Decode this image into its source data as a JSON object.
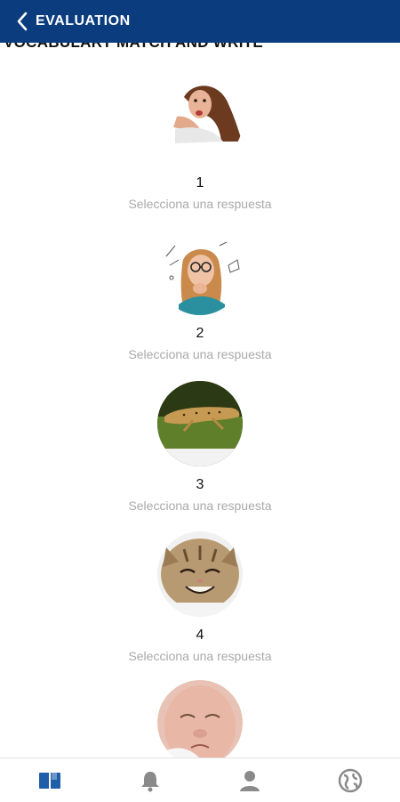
{
  "header": {
    "title": "EVALUATION"
  },
  "section": {
    "title": "VOCABULARY MATCH AND WRITE"
  },
  "items": [
    {
      "number": "1",
      "hint": "Selecciona una respuesta"
    },
    {
      "number": "2",
      "hint": "Selecciona una respuesta"
    },
    {
      "number": "3",
      "hint": "Selecciona una respuesta"
    },
    {
      "number": "4",
      "hint": "Selecciona una respuesta"
    }
  ],
  "nav": {
    "icons": [
      "book-icon",
      "bell-icon",
      "user-icon",
      "globe-icon"
    ],
    "active_color": "#1f5ea8",
    "inactive_color": "#8a8a8a"
  },
  "colors": {
    "header": "#0b3d7e",
    "hint": "#a9a9a9"
  }
}
